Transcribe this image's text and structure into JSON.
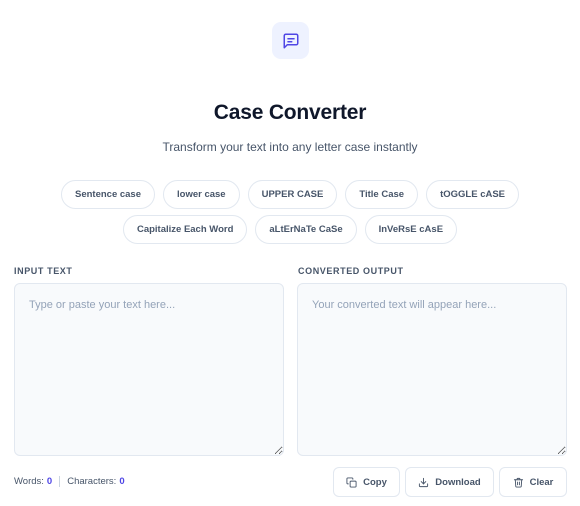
{
  "header": {
    "icon": "message-square-icon",
    "accent_color": "#4f46e5",
    "title": "Case Converter",
    "subtitle": "Transform your text into any letter case instantly"
  },
  "case_options": {
    "row1": [
      "Sentence case",
      "lower case",
      "UPPER CASE",
      "Title Case",
      "tOGGLE cASE"
    ],
    "row2": [
      "Capitalize Each Word",
      "aLtErNaTe CaSe",
      "InVeRsE cAsE"
    ]
  },
  "input": {
    "label": "INPUT TEXT",
    "placeholder": "Type or paste your text here...",
    "value": ""
  },
  "output": {
    "label": "CONVERTED OUTPUT",
    "placeholder": "Your converted text will appear here...",
    "value": ""
  },
  "stats": {
    "words_label": "Words:",
    "words": "0",
    "characters_label": "Characters:",
    "characters": "0"
  },
  "actions": {
    "copy": {
      "label": "Copy",
      "icon": "copy-icon"
    },
    "download": {
      "label": "Download",
      "icon": "download-icon"
    },
    "clear": {
      "label": "Clear",
      "icon": "trash-icon"
    }
  }
}
